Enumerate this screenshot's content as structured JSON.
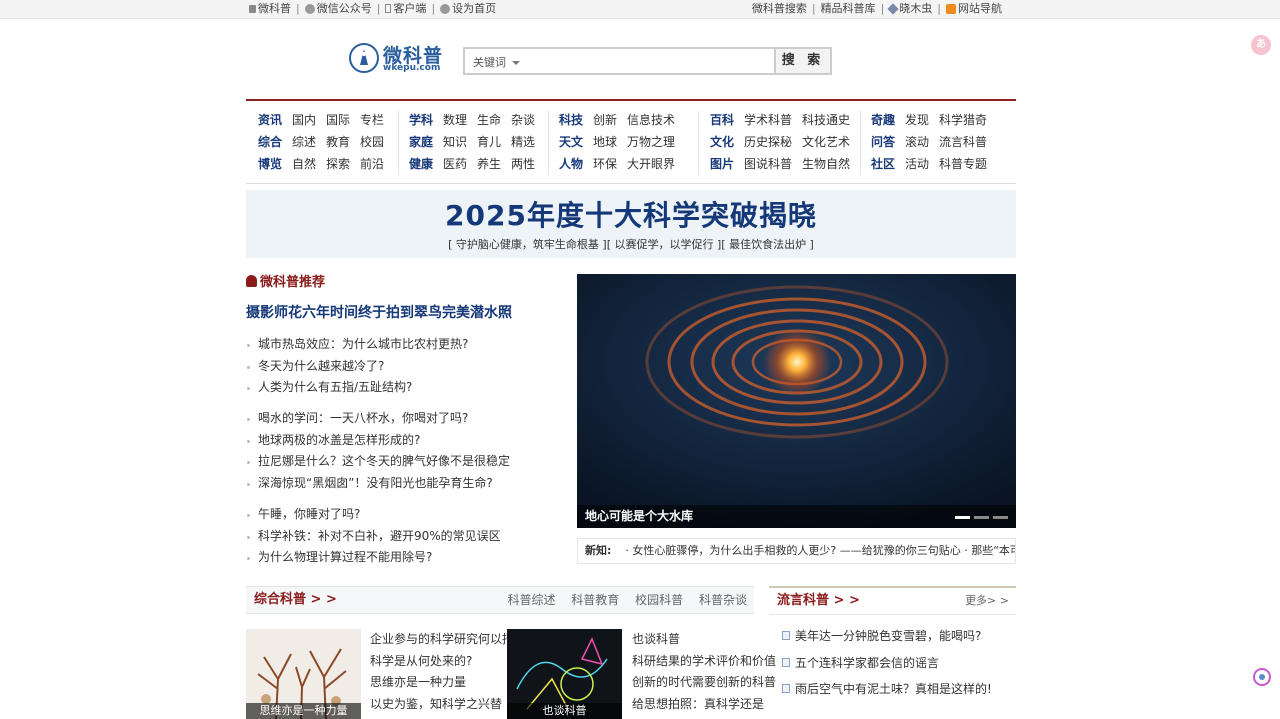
{
  "topbar": {
    "left": [
      "微科普",
      "微信公众号",
      "客户端",
      "设为首页"
    ],
    "right": [
      "微科普搜索",
      "精品科普库",
      "晓木虫",
      "网站导航"
    ]
  },
  "logo": {
    "cn": "微科普",
    "en": "wkepu.com"
  },
  "search": {
    "keyword_label": "关键词",
    "button": "搜 索",
    "value": ""
  },
  "nav": [
    {
      "rows": [
        {
          "cat": "资讯",
          "links": [
            "国内",
            "国际",
            "专栏"
          ]
        },
        {
          "cat": "综合",
          "links": [
            "综述",
            "教育",
            "校园"
          ]
        },
        {
          "cat": "博览",
          "links": [
            "自然",
            "探索",
            "前沿"
          ]
        }
      ]
    },
    {
      "rows": [
        {
          "cat": "学科",
          "links": [
            "数理",
            "生命",
            "杂谈"
          ]
        },
        {
          "cat": "家庭",
          "links": [
            "知识",
            "育儿",
            "精选"
          ]
        },
        {
          "cat": "健康",
          "links": [
            "医药",
            "养生",
            "两性"
          ]
        }
      ]
    },
    {
      "rows": [
        {
          "cat": "科技",
          "links": [
            "创新",
            "信息技术"
          ]
        },
        {
          "cat": "天文",
          "links": [
            "地球",
            "万物之理"
          ]
        },
        {
          "cat": "人物",
          "links": [
            "环保",
            "大开眼界"
          ]
        }
      ]
    },
    {
      "rows": [
        {
          "cat": "百科",
          "links": [
            "学术科普",
            "科技通史"
          ]
        },
        {
          "cat": "文化",
          "links": [
            "历史探秘",
            "文化艺术"
          ]
        },
        {
          "cat": "图片",
          "links": [
            "图说科普",
            "生物自然"
          ]
        }
      ]
    },
    {
      "rows": [
        {
          "cat": "奇趣",
          "links": [
            "发现",
            "科学猎奇"
          ]
        },
        {
          "cat": "问答",
          "links": [
            "滚动",
            "流言科普"
          ]
        },
        {
          "cat": "社区",
          "links": [
            "活动",
            "科普专题"
          ]
        }
      ]
    }
  ],
  "banner": {
    "title": "2025年度十大科学突破揭晓",
    "sub": "[ 守护脑心健康，筑牢生命根基 ][ 以赛促学，以学促行 ][ 最佳饮食法出炉 ]"
  },
  "recommend": {
    "title": "微科普推荐",
    "headline": "摄影师花六年时间终于拍到翠鸟完美潜水照",
    "groups": [
      [
        "城市热岛效应：为什么城市比农村更热?",
        "冬天为什么越来越冷了?",
        "人类为什么有五指/五趾结构?"
      ],
      [
        "喝水的学问：一天八杯水，你喝对了吗?",
        "地球两极的冰盖是怎样形成的?",
        "拉尼娜是什么？这个冬天的脾气好像不是很稳定",
        "深海惊现“黑烟囱”！没有阳光也能孕育生命?"
      ],
      [
        "午睡，你睡对了吗?",
        "科学补铁：补对不白补，避开90%的常见误区",
        "为什么物理计算过程不能用除号?"
      ]
    ]
  },
  "slider": {
    "caption": "地心可能是个大水库",
    "slides": 3,
    "active": 1
  },
  "news": {
    "label": "新知:",
    "text": "· 女性心脏骤停，为什么出手相救的人更少? ——给犹豫的你三句贴心 · 那些“本可"
  },
  "panel1": {
    "title": "综合科普 > >",
    "tabs": [
      "科普综述",
      "科普教育",
      "校园科普",
      "科普杂谈"
    ],
    "items": [
      {
        "caption": "思维亦是一种力量",
        "links": [
          "企业参与的科学研究何以招",
          "科学是从何处来的?",
          "思维亦是一种力量",
          "以史为鉴，知科学之兴替"
        ]
      },
      {
        "caption": "也谈科普",
        "links": [
          "也谈科普",
          "科研结果的学术评价和价值",
          "创新的时代需要创新的科普",
          "给思想拍照：真科学还是"
        ]
      }
    ]
  },
  "panel2": {
    "title": "流言科普 > >",
    "more": "更多> >",
    "links": [
      "美年达一分钟脱色变雪碧，能喝吗?",
      "五个连科学家都会信的谣言",
      "雨后空气中有泥土味？真相是这样的!",
      "……"
    ]
  },
  "colors": {
    "accent_red": "#8b1c1c",
    "link_blue": "#143878",
    "brand_blue": "#2a5e9c"
  }
}
